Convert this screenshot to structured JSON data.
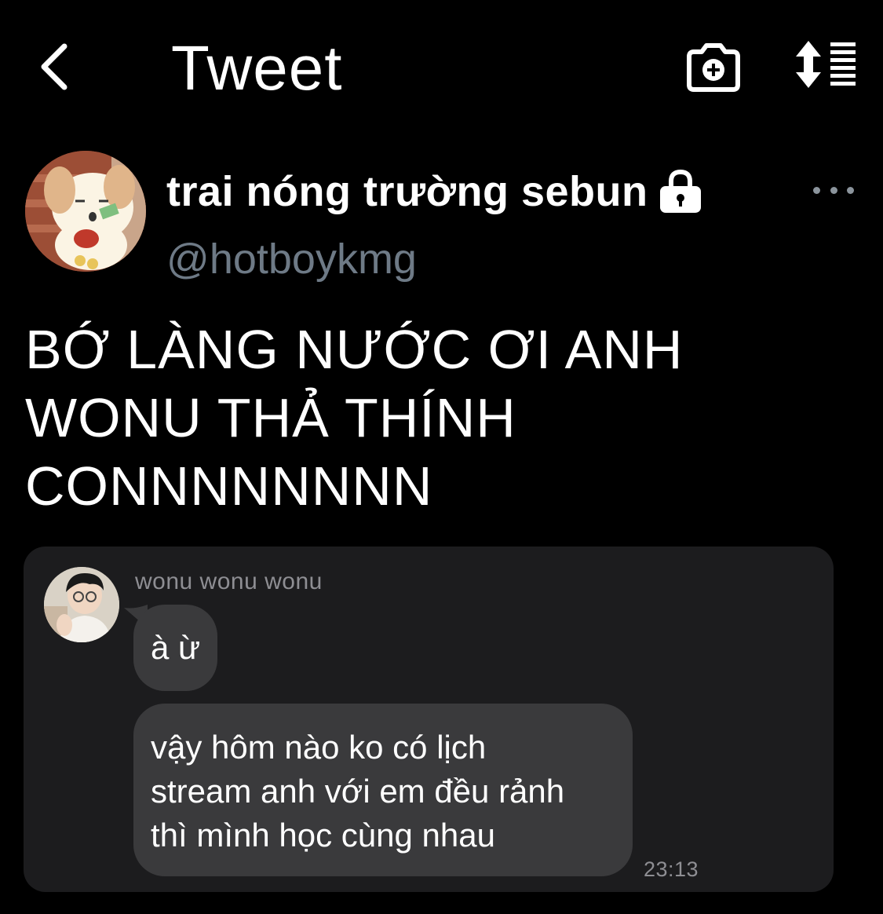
{
  "header": {
    "title": "Tweet",
    "back_icon": "chevron-left-icon",
    "camera_icon": "camera-plus-icon",
    "sort_icon": "sort-list-icon"
  },
  "tweet": {
    "display_name": "trai nóng trường sebun",
    "handle": "@hotboykmg",
    "protected_icon": "lock-icon",
    "more_icon": "ellipsis-icon",
    "text": "BỚ LÀNG NƯỚC ƠI ANH\nWONU THẢ THÍNH\nCONNNNNNNN"
  },
  "media": {
    "sender": "wonu wonu wonu",
    "messages": [
      "à ừ",
      "vậy hôm nào ko có lịch\nstream anh với em đều rảnh\nthì mình học cùng nhau"
    ],
    "time": "23:13"
  },
  "colors": {
    "background": "#000000",
    "text": "#ffffff",
    "handle": "#6e7a86",
    "card": "#1c1c1e",
    "bubble": "#3a3a3c",
    "muted": "#8e8e93"
  }
}
